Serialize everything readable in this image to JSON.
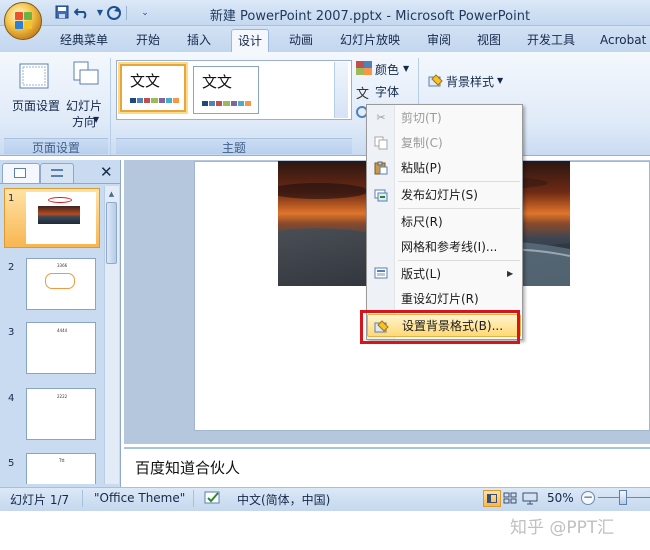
{
  "window": {
    "title": "新建 PowerPoint 2007.pptx - Microsoft PowerPoint"
  },
  "tabs": [
    "经典菜单",
    "开始",
    "插入",
    "设计",
    "动画",
    "幻灯片放映",
    "审阅",
    "视图",
    "开发工具",
    "Acrobat"
  ],
  "active_tab": "设计",
  "ribbon": {
    "page_setup": {
      "page_setup_label": "页面设置",
      "orientation_label_1": "幻灯片",
      "orientation_label_2": "方向",
      "group_label": "页面设置"
    },
    "themes": {
      "thumb_text": "文文",
      "group_label": "主题",
      "colors_label": "颜色",
      "fonts_label": "字体"
    },
    "background": {
      "background_styles_label": "背景样式"
    }
  },
  "slides": [
    {
      "num": "1",
      "text": ""
    },
    {
      "num": "2",
      "text": "3366"
    },
    {
      "num": "3",
      "text": "4444"
    },
    {
      "num": "4",
      "text": "2222"
    },
    {
      "num": "5",
      "text": "Ttt"
    }
  ],
  "notes": {
    "text": "百度知道合伙人"
  },
  "context_menu": {
    "items": [
      {
        "label": "剪切(T)",
        "icon": "scissors-icon",
        "disabled": true
      },
      {
        "label": "复制(C)",
        "icon": "copy-icon",
        "disabled": true
      },
      {
        "label": "粘贴(P)",
        "icon": "paste-icon",
        "disabled": false
      },
      {
        "label": "发布幻灯片(S)",
        "icon": "publish-slides-icon",
        "disabled": false
      },
      {
        "label": "标尺(R)",
        "icon": "",
        "disabled": false
      },
      {
        "label": "网格和参考线(I)...",
        "icon": "",
        "disabled": false
      },
      {
        "label": "版式(L)",
        "icon": "layout-icon",
        "disabled": false
      },
      {
        "label": "重设幻灯片(R)",
        "icon": "",
        "disabled": false
      },
      {
        "label": "设置背景格式(B)...",
        "icon": "format-background-icon",
        "disabled": false,
        "highlighted": true
      }
    ]
  },
  "statusbar": {
    "slide_counter": "幻灯片 1/7",
    "theme_name": "\"Office Theme\"",
    "language": "中文(简体，中国)",
    "zoom": "50%"
  },
  "watermark": "知乎 @PPT汇",
  "colors": {
    "accent_highlight": "#ffd974",
    "red_box": "#d9131a",
    "ribbon_blue": "#dfeaf8"
  }
}
